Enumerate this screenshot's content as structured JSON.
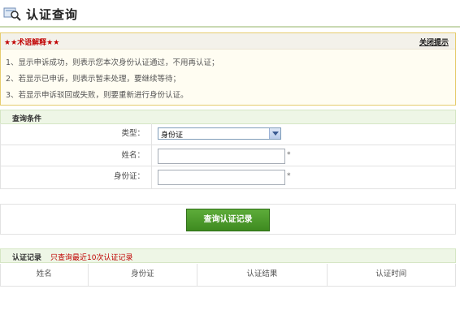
{
  "header": {
    "title": "认证查询",
    "icon": "search-magnifier-icon"
  },
  "notice": {
    "title": "★★术语解释★★",
    "close_label": "关闭提示",
    "lines": [
      "1、显示申诉成功，则表示您本次身份认证通过，不用再认证；",
      "2、若显示已申诉，则表示暂未处理，要继续等待；",
      "3、若显示申诉驳回或失败，则要重新进行身份认证。"
    ]
  },
  "query": {
    "section_label": "查询条件",
    "type_label": "类型：",
    "type_value": "身份证",
    "name_label": "姓名：",
    "name_value": "",
    "id_label": "身份证：",
    "id_value": "",
    "required_mark": "*",
    "submit_label": "查询认证记录"
  },
  "records": {
    "section_label": "认证记录",
    "hint": "只查询最近10次认证记录",
    "columns": [
      "姓名",
      "身份证",
      "认证结果",
      "认证时间"
    ]
  },
  "colors": {
    "accent_green": "#3e8a20",
    "warning_red": "#c00000",
    "notice_border": "#e6cc6e"
  }
}
